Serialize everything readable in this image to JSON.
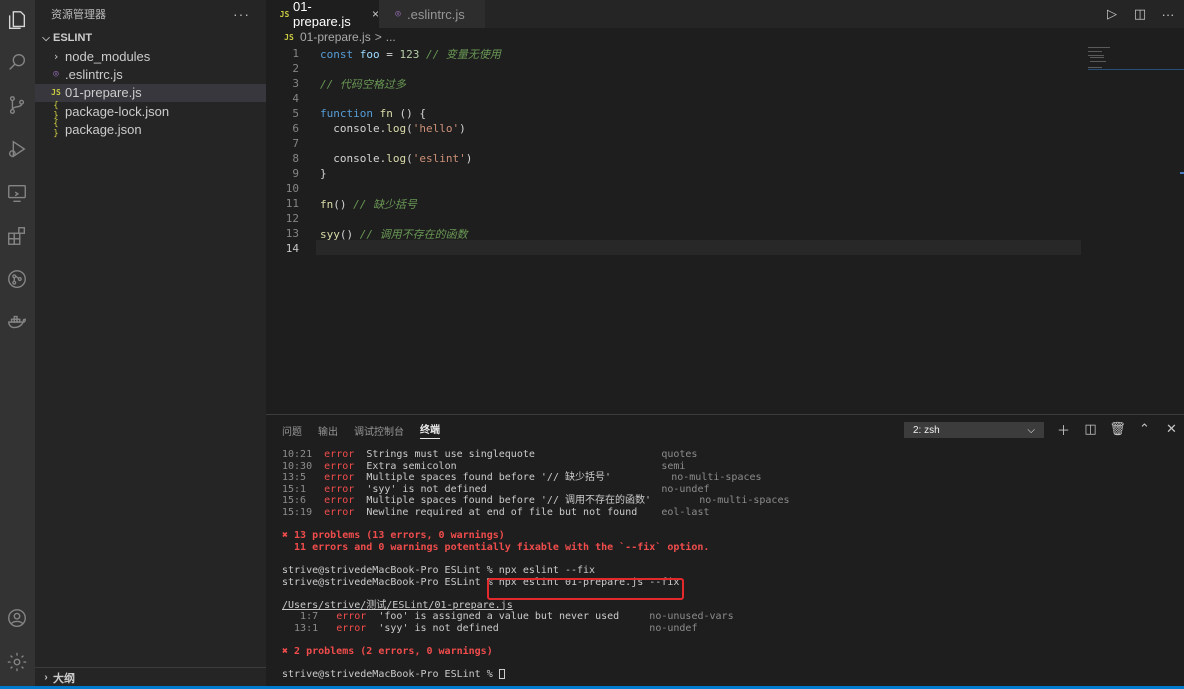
{
  "sidebar": {
    "title": "资源管理器",
    "more": "···",
    "section": "ESLINT",
    "items": [
      {
        "label": "node_modules",
        "icon": "chevron-right"
      },
      {
        "label": ".eslintrc.js",
        "icon": "eslint-config"
      },
      {
        "label": "01-prepare.js",
        "icon": "JS"
      },
      {
        "label": "package-lock.json",
        "icon": "{ }"
      },
      {
        "label": "package.json",
        "icon": "{ }"
      }
    ],
    "outline": "大纲"
  },
  "tabs": [
    {
      "label": "01-prepare.js",
      "icon": "JS",
      "close": "×"
    },
    {
      "label": ".eslintrc.js",
      "icon": "eslint-config"
    }
  ],
  "breadcrumb": {
    "file": "01-prepare.js",
    "sep": ">",
    "rest": "..."
  },
  "editor": {
    "line_numbers": [
      "1",
      "2",
      "3",
      "4",
      "5",
      "6",
      "7",
      "8",
      "9",
      "10",
      "11",
      "12",
      "13",
      "14"
    ],
    "lines": {
      "l1": {
        "a": "const",
        "b": "foo",
        "c": "=",
        "d": "123",
        "e": "// 变量无使用"
      },
      "l3": {
        "e": "// 代码空格过多"
      },
      "l5": {
        "a": "function",
        "b": "fn",
        "c": "() {"
      },
      "l6": {
        "a": "  console.",
        "b": "log",
        "c": "(",
        "d": "'hello'",
        "e": ")"
      },
      "l8": {
        "a": "  console.",
        "b": "log",
        "c": "(",
        "d": "'eslint'",
        "e": ")"
      },
      "l9": {
        "a": "}"
      },
      "l11": {
        "a": "fn",
        "b": "()",
        "e": "// 缺少括号"
      },
      "l13": {
        "a": "syy",
        "b": "()",
        "e": "// 调用不存在的函数"
      }
    }
  },
  "panel": {
    "tabs": [
      "问题",
      "输出",
      "调试控制台",
      "终端"
    ],
    "terminal_select": "2: zsh",
    "terminal": {
      "rows": [
        {
          "pos": "10:21",
          "level": "error",
          "msg": "Strings must use singlequote                  ",
          "rule": "quotes"
        },
        {
          "pos": "10:30",
          "level": "error",
          "msg": "Extra semicolon                               ",
          "rule": "semi"
        },
        {
          "pos": "13:5 ",
          "level": "error",
          "msg": "Multiple spaces found before '// 缺少括号'       ",
          "rule": "no-multi-spaces"
        },
        {
          "pos": "15:1 ",
          "level": "error",
          "msg": "'syy' is not defined                          ",
          "rule": "no-undef"
        },
        {
          "pos": "15:6 ",
          "level": "error",
          "msg": "Multiple spaces found before '// 调用不存在的函数'     ",
          "rule": "no-multi-spaces"
        },
        {
          "pos": "15:19",
          "level": "error",
          "msg": "Newline required at end of file but not found ",
          "rule": "eol-last"
        }
      ],
      "summary1": "✖ 13 problems (13 errors, 0 warnings)",
      "summary2": "  11 errors and 0 warnings potentially fixable with the `--fix` option.",
      "cmd1": "strive@strivedeMacBook-Pro ESLint % npx eslint --fix",
      "cmd2_prompt": "strive@strivedeMacBook-Pro ESLint % ",
      "cmd2": "npx eslint 01-prepare.js --fix",
      "path": "/Users/strive/测试/ESLint/01-prepare.js",
      "rows2": [
        {
          "pos": "   1:7 ",
          "level": "error",
          "msg": "'foo' is assigned a value but never used  ",
          "rule": "no-unused-vars"
        },
        {
          "pos": "  13:1 ",
          "level": "error",
          "msg": "'syy' is not defined                      ",
          "rule": "no-undef"
        }
      ],
      "summary3": "✖ 2 problems (2 errors, 0 warnings)",
      "prompt3": "strive@strivedeMacBook-Pro ESLint % "
    }
  },
  "colors": {
    "accent": "#007acc",
    "error": "#f14c4c",
    "highlight_box": "#e3292b"
  }
}
